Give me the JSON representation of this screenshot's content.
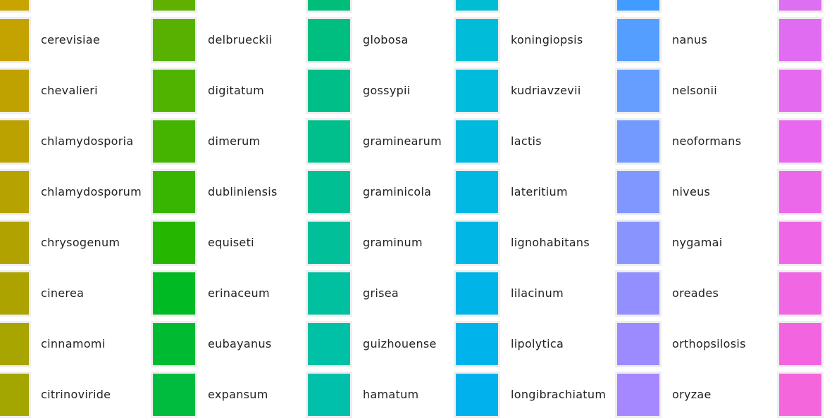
{
  "columns": [
    {
      "name": "column-1",
      "items": [
        {
          "label": "",
          "color": "#c8a400"
        },
        {
          "label": "cerevisiae",
          "color": "#c4a200"
        },
        {
          "label": "chevalieri",
          "color": "#bfa200"
        },
        {
          "label": "chlamydosporia",
          "color": "#bba200"
        },
        {
          "label": "chlamydosporum",
          "color": "#b6a200"
        },
        {
          "label": "chrysogenum",
          "color": "#b1a200"
        },
        {
          "label": "cinerea",
          "color": "#aca300"
        },
        {
          "label": "cinnamomi",
          "color": "#a8a400"
        },
        {
          "label": "citrinoviride",
          "color": "#a3a500"
        }
      ]
    },
    {
      "name": "column-2",
      "items": [
        {
          "label": "",
          "color": "#5fb000"
        },
        {
          "label": "delbrueckii",
          "color": "#58b100"
        },
        {
          "label": "digitatum",
          "color": "#4fb300"
        },
        {
          "label": "dimerum",
          "color": "#45b400"
        },
        {
          "label": "dubliniensis",
          "color": "#38b500"
        },
        {
          "label": "equiseti",
          "color": "#25b700"
        },
        {
          "label": "erinaceum",
          "color": "#00ba23"
        },
        {
          "label": "eubayanus",
          "color": "#00bb32"
        },
        {
          "label": "expansum",
          "color": "#00bc3e"
        }
      ]
    },
    {
      "name": "column-3",
      "items": [
        {
          "label": "",
          "color": "#00bd7a"
        },
        {
          "label": "globosa",
          "color": "#00be80"
        },
        {
          "label": "gossypii",
          "color": "#00be87"
        },
        {
          "label": "graminearum",
          "color": "#00bf8d"
        },
        {
          "label": "graminicola",
          "color": "#00bf93"
        },
        {
          "label": "graminum",
          "color": "#00bf99"
        },
        {
          "label": "grisea",
          "color": "#00c09f"
        },
        {
          "label": "guizhouense",
          "color": "#00c0a5"
        },
        {
          "label": "hamatum",
          "color": "#00c0ab"
        }
      ]
    },
    {
      "name": "column-4",
      "items": [
        {
          "label": "",
          "color": "#00bdd4"
        },
        {
          "label": "koningiopsis",
          "color": "#00bcd8"
        },
        {
          "label": "kudriavzevii",
          "color": "#00bbdb"
        },
        {
          "label": "lactis",
          "color": "#00b9de"
        },
        {
          "label": "lateritium",
          "color": "#00b8e1"
        },
        {
          "label": "lignohabitans",
          "color": "#00b6e4"
        },
        {
          "label": "lilacinum",
          "color": "#00b4e7"
        },
        {
          "label": "lipolytica",
          "color": "#00b3ea"
        },
        {
          "label": "longibrachiatum",
          "color": "#00b1ee"
        }
      ]
    },
    {
      "name": "column-5",
      "items": [
        {
          "label": "",
          "color": "#419cff"
        },
        {
          "label": "nanus",
          "color": "#549eff"
        },
        {
          "label": "nelsonii",
          "color": "#659eff"
        },
        {
          "label": "neoformans",
          "color": "#739bff"
        },
        {
          "label": "niveus",
          "color": "#7f97ff"
        },
        {
          "label": "nygamai",
          "color": "#8a94ff"
        },
        {
          "label": "oreades",
          "color": "#948fff"
        },
        {
          "label": "orthopsilosis",
          "color": "#9c8bff"
        },
        {
          "label": "oryzae",
          "color": "#a587ff"
        }
      ]
    },
    {
      "name": "column-6",
      "items": [
        {
          "label": "",
          "color": "#dc6ff2"
        },
        {
          "label": "",
          "color": "#e06cf1"
        },
        {
          "label": "",
          "color": "#e46af0"
        },
        {
          "label": "",
          "color": "#e868ef"
        },
        {
          "label": "",
          "color": "#ec68ea"
        },
        {
          "label": "",
          "color": "#ef67e7"
        },
        {
          "label": "",
          "color": "#f166e3"
        },
        {
          "label": "",
          "color": "#f365e0"
        },
        {
          "label": "",
          "color": "#f466dc"
        }
      ]
    }
  ]
}
